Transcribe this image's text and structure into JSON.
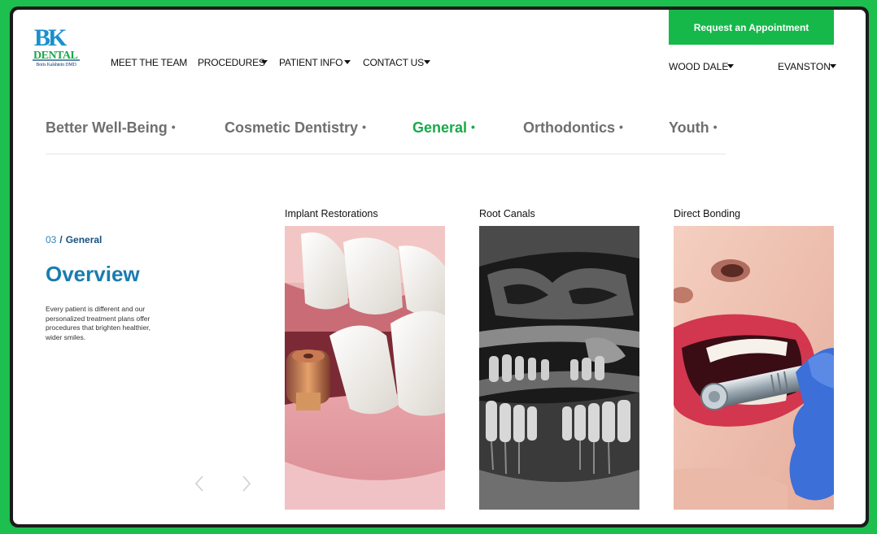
{
  "brand": {
    "logo_letters": "BK",
    "logo_word": "DENTAL",
    "logo_subtitle": "Boris Kalshtein DMD"
  },
  "nav": {
    "items": [
      {
        "label": "MEET THE TEAM",
        "has_dropdown": false
      },
      {
        "label": "PROCEDURES",
        "has_dropdown": true
      },
      {
        "label": "PATIENT INFO",
        "has_dropdown": true
      },
      {
        "label": "CONTACT US",
        "has_dropdown": true
      }
    ],
    "cta_label": "Request an Appointment",
    "locations": [
      "WOOD DALE",
      "EVANSTON"
    ]
  },
  "categories": {
    "tabs": [
      {
        "label": "Better Well-Being",
        "active": false
      },
      {
        "label": "Cosmetic Dentistry",
        "active": false
      },
      {
        "label": "General",
        "active": true
      },
      {
        "label": "Orthodontics",
        "active": false
      },
      {
        "label": "Youth",
        "active": false
      }
    ],
    "bullet": "•"
  },
  "section": {
    "number": "03",
    "separator": "/",
    "category": "General",
    "title": "Overview",
    "description": "Every patient is different and our personalized treatment plans offer procedures that brighten healthier, wider smiles."
  },
  "carousel": {
    "prev_icon": "chevron-left-icon",
    "next_icon": "chevron-right-icon",
    "cards": [
      {
        "title": "Implant Restorations",
        "image": "dental-implant-photo"
      },
      {
        "title": "Root Canals",
        "image": "panoramic-dental-xray"
      },
      {
        "title": "Direct Bonding",
        "image": "dental-drill-photo"
      }
    ]
  },
  "colors": {
    "page_background": "#1dbf4f",
    "accent_green": "#17b84a",
    "active_tab": "#18a94a",
    "heading_blue": "#1a7cb0",
    "inactive_tab": "#6f6f6f"
  }
}
